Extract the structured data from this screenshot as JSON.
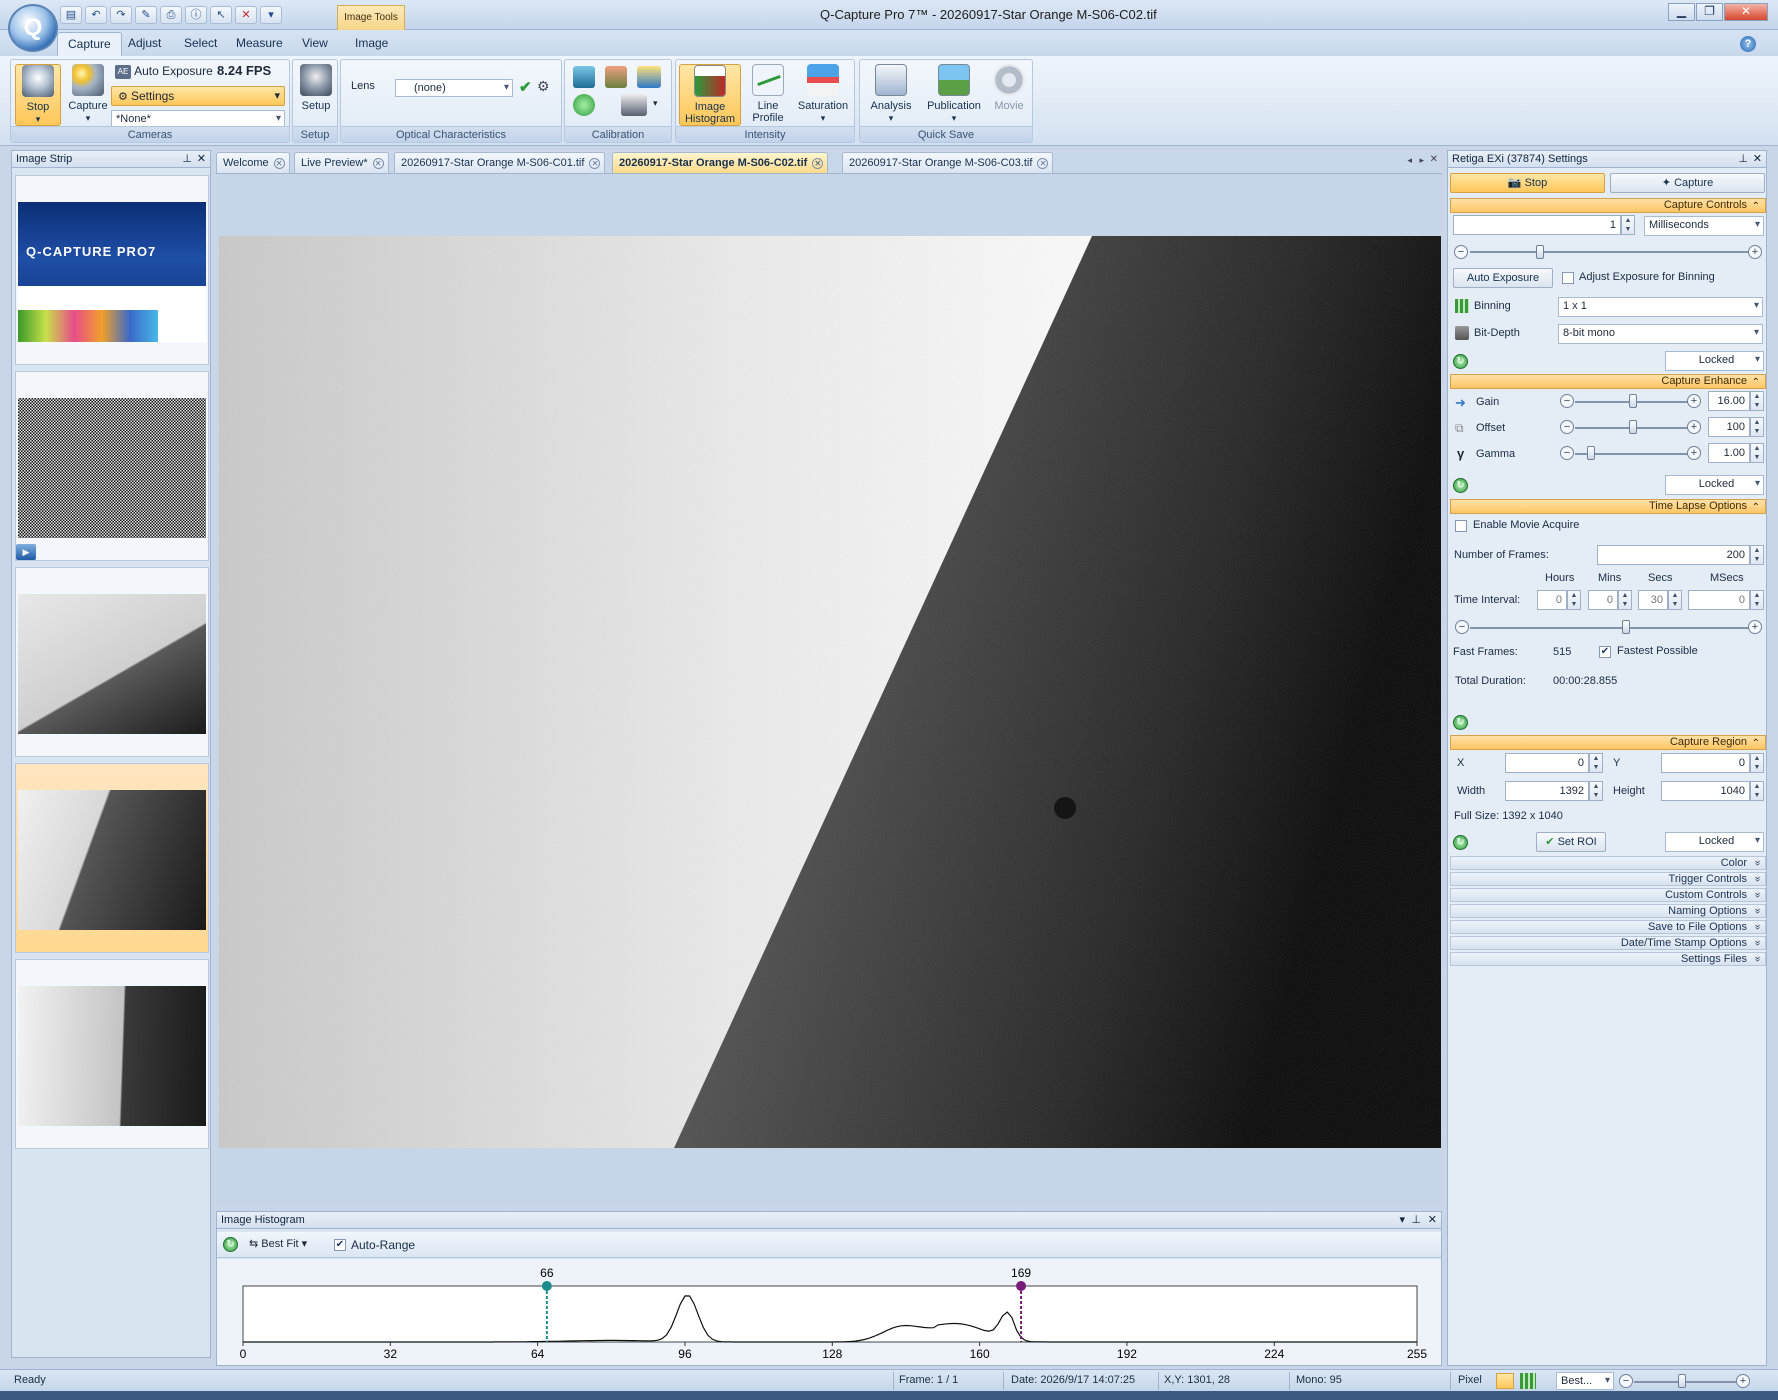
{
  "window": {
    "title": "Q-Capture Pro 7™ - 20260917-Star Orange M-S06-C02.tif",
    "context_tab": "Image Tools"
  },
  "ribbon_tabs": [
    "Capture",
    "Adjust",
    "Select",
    "Measure",
    "View",
    "Image"
  ],
  "ribbon": {
    "stop_label": "Stop",
    "capture_label": "Capture",
    "auto_exposure_label": "Auto Exposure",
    "fps": "8.24 FPS",
    "settings_label": "Settings",
    "preset_value": "*None*",
    "cameras_group": "Cameras",
    "setup_label": "Setup",
    "setup_group": "Setup",
    "lens_label": "Lens",
    "lens_value": "(none)",
    "optical_group": "Optical Characteristics",
    "calibration_group": "Calibration",
    "image_histogram_label": "Image Histogram",
    "line_profile_label": "Line Profile",
    "saturation_label": "Saturation",
    "intensity_group": "Intensity",
    "analysis_label": "Analysis",
    "publication_label": "Publication",
    "movie_label": "Movie",
    "quicksave_group": "Quick Save"
  },
  "image_strip": {
    "title": "Image Strip",
    "logo_text": "Q-CAPTURE PRO7"
  },
  "doc_tabs": [
    "Welcome",
    "Live Preview*",
    "20260917-Star Orange M-S06-C01.tif",
    "20260917-Star Orange M-S06-C02.tif",
    "20260917-Star Orange M-S06-C03.tif"
  ],
  "histogram": {
    "title": "Image Histogram",
    "fit_label": "Best Fit",
    "auto_range_label": "Auto-Range",
    "low_marker": "66",
    "high_marker": "169",
    "low_value": 66,
    "high_value": 169,
    "x_ticks": [
      "0",
      "32",
      "64",
      "96",
      "128",
      "160",
      "192",
      "224",
      "255"
    ]
  },
  "settings": {
    "title": "Retiga EXi (37874) Settings",
    "stop_label": "Stop",
    "capture_label": "Capture",
    "capture_controls": "Capture Controls",
    "exposure_value": "1",
    "exposure_unit": "Milliseconds",
    "auto_exposure_btn": "Auto Exposure",
    "adjust_binning_label": "Adjust Exposure for Binning",
    "binning_label": "Binning",
    "binning_value": "1 x 1",
    "bitdepth_label": "Bit-Depth",
    "bitdepth_value": "8-bit mono",
    "locked": "Locked",
    "capture_enhance": "Capture Enhance",
    "gain_label": "Gain",
    "gain_value": "16.00",
    "offset_label": "Offset",
    "offset_value": "100",
    "gamma_label": "Gamma",
    "gamma_value": "1.00",
    "time_lapse": "Time Lapse Options",
    "enable_movie_label": "Enable Movie Acquire",
    "frames_label": "Number of  Frames:",
    "frames_value": "200",
    "hours_label": "Hours",
    "mins_label": "Mins",
    "secs_label": "Secs",
    "msecs_label": "MSecs",
    "interval_label": "Time Interval:",
    "hours_value": "0",
    "mins_value": "0",
    "secs_value": "30",
    "msecs_value": "0",
    "fast_frames_label": "Fast Frames:",
    "fast_frames_value": "515",
    "fastest_label": "Fastest Possible",
    "duration_label": "Total Duration:",
    "duration_value": "00:00:28.855",
    "capture_region": "Capture Region",
    "x_label": "X",
    "x_value": "0",
    "y_label": "Y",
    "y_value": "0",
    "width_label": "Width",
    "width_value": "1392",
    "height_label": "Height",
    "height_value": "1040",
    "full_size": "Full Size: 1392 x 1040",
    "set_roi": "Set ROI",
    "collapsed": [
      "Color",
      "Trigger Controls",
      "Custom Controls",
      "Naming Options",
      "Save to File Options",
      "Date/Time Stamp Options",
      "Settings Files"
    ]
  },
  "status": {
    "ready": "Ready",
    "frame": "Frame: 1 / 1",
    "date": "Date: 2026/9/17 14:07:25",
    "xy": "X,Y: 1301,    28",
    "mono": "Mono:    95",
    "pixel": "Pixel",
    "zoom": "Best..."
  },
  "colors": {
    "accent": "#ffc75a",
    "chrome": "#c8d6e8",
    "low_marker": "#1a8c8c",
    "high_marker": "#7a1a7a"
  }
}
